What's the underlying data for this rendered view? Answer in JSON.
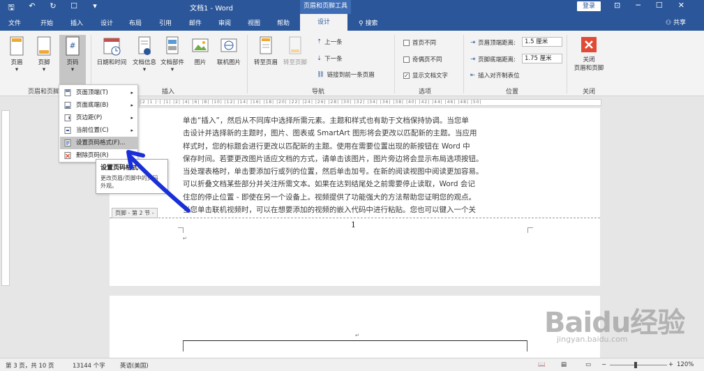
{
  "titlebar": {
    "doc_title": "文档1 - Word",
    "context_header": "页眉和页脚工具",
    "login": "登录"
  },
  "tabs": [
    "文件",
    "开始",
    "插入",
    "设计",
    "布局",
    "引用",
    "邮件",
    "审阅",
    "视图",
    "帮助"
  ],
  "active_tab": "设计",
  "search": "搜索",
  "share": "共享",
  "ribbon": {
    "hf_group": {
      "header": "页眉",
      "footer": "页脚",
      "page_number": "页码",
      "label": "页眉和页脚"
    },
    "insert_group": {
      "datetime": "日期和时间",
      "docinfo": "文档信息",
      "docparts": "文档部件",
      "picture": "图片",
      "online_picture": "联机图片",
      "label": "插入"
    },
    "nav_group": {
      "goto_header": "转至页眉",
      "goto_footer": "转至页脚",
      "prev": "上一条",
      "next": "下一条",
      "link_prev": "链接到前一条页眉",
      "label": "导航"
    },
    "options_group": {
      "first_page": "首页不同",
      "odd_even": "奇偶页不同",
      "show_text": "显示文档文字",
      "label": "选项"
    },
    "position_group": {
      "header_top": "页眉顶端距离:",
      "header_top_value": "1.5 厘米",
      "footer_bottom": "页脚底端距离:",
      "footer_bottom_value": "1.75 厘米",
      "insert_align_tab": "插入对齐制表位",
      "label": "位置"
    },
    "close_group": {
      "close": "关闭",
      "close_sub": "页眉和页脚",
      "label": "关闭"
    }
  },
  "menu": {
    "items": [
      {
        "label": "页面顶端(T)",
        "arrow": "▸"
      },
      {
        "label": "页面底端(B)",
        "arrow": "▸"
      },
      {
        "label": "页边距(P)",
        "arrow": "▸"
      },
      {
        "label": "当前位置(C)",
        "arrow": "▸"
      },
      {
        "label": "设置页码格式(F)...",
        "arrow": ""
      },
      {
        "label": "删除页码(R)",
        "arrow": ""
      }
    ]
  },
  "tooltip": {
    "title": "设置页码格式",
    "desc": "更改页眉/页脚中的页码外观。"
  },
  "document": {
    "lines": [
      "单击“插入”，然后从不同库中选择所需元素。主题和样式也有助于文档保持协调。当您单",
      "击设计并选择新的主题时，图片、图表或 SmartArt 图形将会更改以匹配新的主题。当应用",
      "样式时，您的标题会进行更改以匹配新的主题。使用在需要位置出现的新按钮在 Word 中",
      "保存时间。若要更改图片适应文档的方式，请单击该图片，图片旁边将会显示布局选项按钮。",
      "当处理表格时，单击要添加行或列的位置，然后单击加号。在新的阅读视图中阅读更加容易。",
      "可以折叠文档某些部分并关注所需文本。如果在达到结尾处之前需要停止读取，Word 会记",
      "住您的停止位置 - 即使在另一个设备上。视频提供了功能强大的方法帮助您证明您的观点。",
      "当您单击联机视频时，可以在想要添加的视频的嵌入代码中进行粘贴。您也可以键入一个关"
    ],
    "footer_tag": "页脚 - 第 2 节 -",
    "page_number": "1"
  },
  "statusbar": {
    "page": "第 3 页，共 10 页",
    "words": "13144 个字",
    "lang": "英语(美国)",
    "zoom": "120%"
  },
  "colors": {
    "word_blue": "#2b579a",
    "annotation_arrow": "#1a2fd6",
    "close_red": "#e04b36"
  },
  "watermark": {
    "brand": "Baidu经验",
    "url": "jingyan.baidu.com"
  }
}
